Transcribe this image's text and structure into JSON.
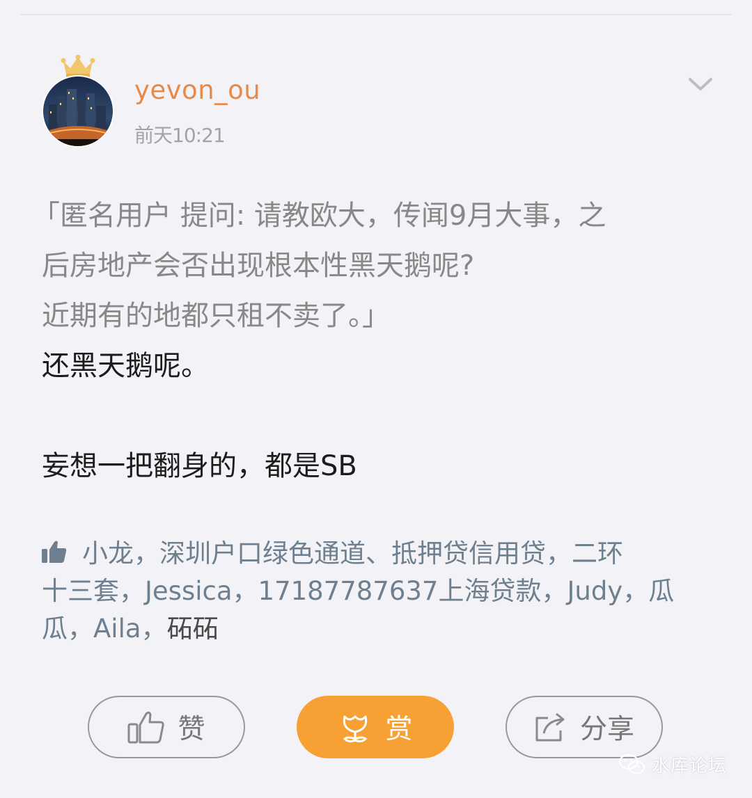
{
  "post": {
    "author": "yevon_ou",
    "timestamp": "前天10:21",
    "quote_lines": [
      "「匿名用户  提问: 请教欧大，传闻9月大事，之",
      "后房地产会否出现根本性黑天鹅呢?",
      "近期有的地都只租不卖了。」"
    ],
    "reply_lines": [
      "还黑天鹅呢。",
      "",
      "妄想一把翻身的，都是SB"
    ],
    "likes_lines": [
      "小龙，深圳户口绿色通道、抵押贷信用贷，二环",
      "十三套，Jessica，17187787637上海贷款，Judy，瓜",
      "瓜，Aila，"
    ],
    "likes_last_name": "砳砳"
  },
  "actions": {
    "like_label": "赞",
    "reward_label": "赏",
    "share_label": "分享"
  },
  "watermark": {
    "text": "水库论坛"
  },
  "colors": {
    "background": "#f3f3f7",
    "author": "#e7894a",
    "likes": "#6e8090",
    "reward": "#f7a034"
  },
  "icons": [
    "crown-icon",
    "avatar",
    "chevron-down-icon",
    "thumbs-up-icon",
    "flower-icon",
    "share-icon",
    "wechat-icon"
  ]
}
